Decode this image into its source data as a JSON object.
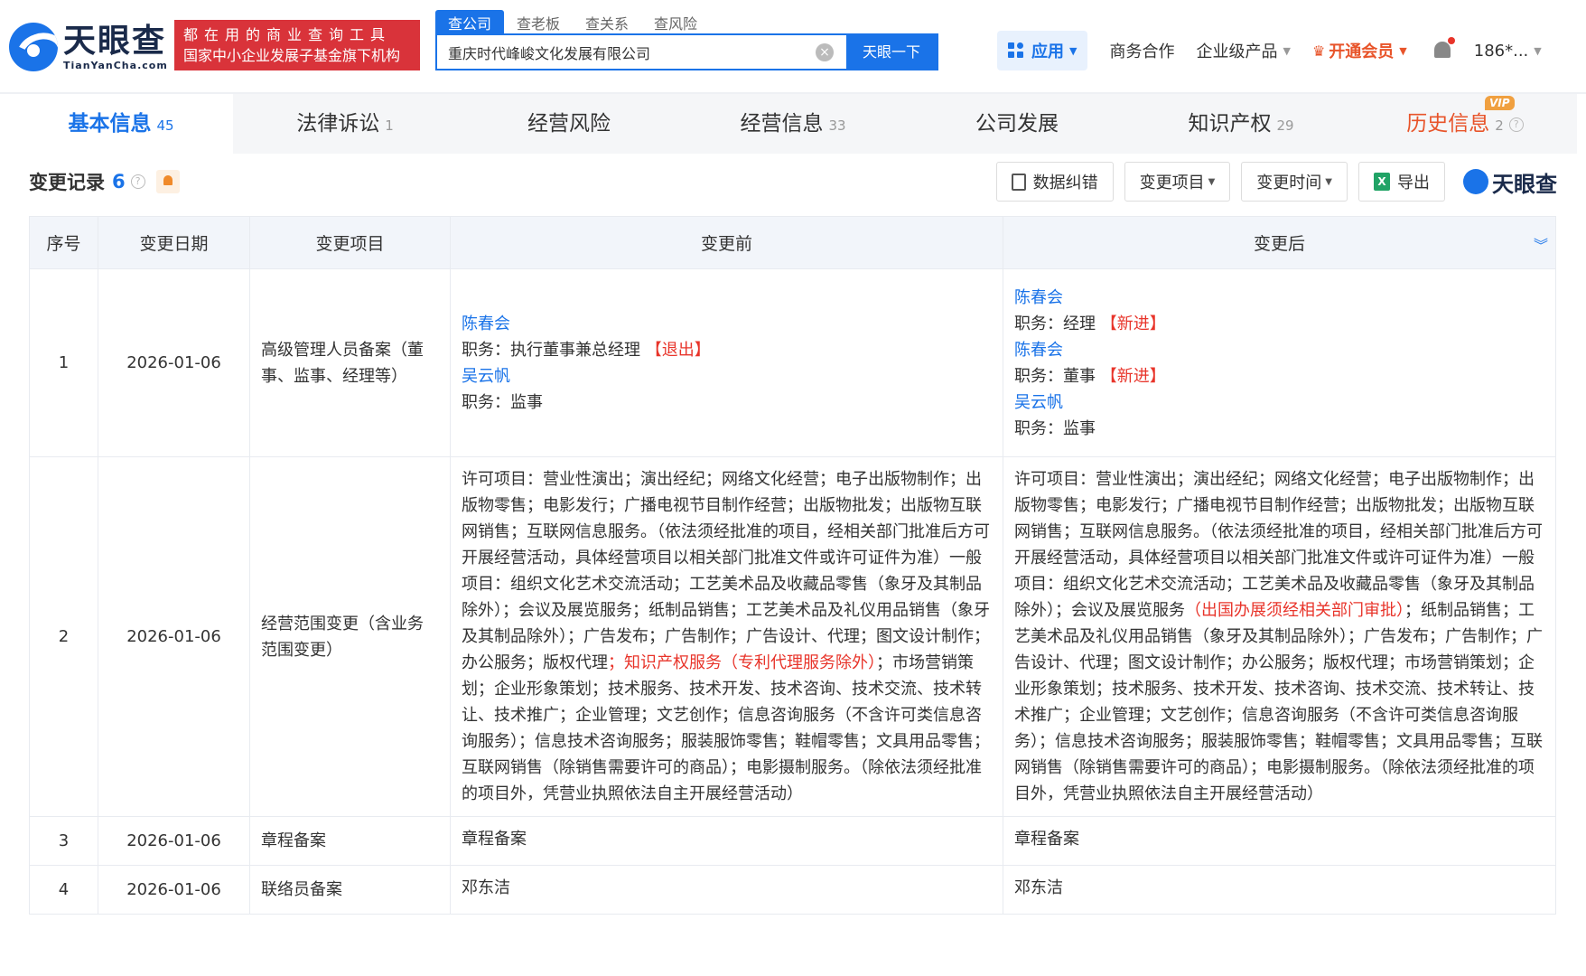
{
  "header": {
    "logo_cn": "天眼查",
    "logo_en": "TianYanCha.com",
    "slogan_line1": "都在用的商业查询工具",
    "slogan_line2": "国家中小企业发展子基金旗下机构",
    "search_tabs": [
      "查公司",
      "查老板",
      "查关系",
      "查风险"
    ],
    "search_value": "重庆时代峰峻文化发展有限公司",
    "search_button": "天眼一下",
    "apps_label": "应用",
    "nav_business": "商务合作",
    "nav_enterprise": "企业级产品",
    "nav_member": "开通会员",
    "user": "186*..."
  },
  "category_tabs": [
    {
      "label": "基本信息",
      "count": "45"
    },
    {
      "label": "法律诉讼",
      "count": "1"
    },
    {
      "label": "经营风险",
      "count": ""
    },
    {
      "label": "经营信息",
      "count": "33"
    },
    {
      "label": "公司发展",
      "count": ""
    },
    {
      "label": "知识产权",
      "count": "29"
    },
    {
      "label": "历史信息",
      "count": "2",
      "badge": "VIP"
    }
  ],
  "section": {
    "title": "变更记录",
    "count": "6",
    "tools": {
      "correction": "数据纠错",
      "change_item": "变更项目",
      "change_time": "变更时间",
      "export": "导出"
    },
    "brand": "天眼查"
  },
  "table": {
    "headers": [
      "序号",
      "变更日期",
      "变更项目",
      "变更前",
      "变更后"
    ],
    "rows": [
      {
        "no": "1",
        "date": "2026-01-06",
        "item": "高级管理人员备案（董事、监事、经理等）",
        "before": {
          "p1_name": "陈春会",
          "p1_role": "职务：执行董事兼总经理",
          "p1_tag": "【退出】",
          "p2_name": "吴云帆",
          "p2_role": "职务：监事"
        },
        "after": {
          "p1_name": "陈春会",
          "p1_role": "职务：经理",
          "p1_tag": "【新进】",
          "p2_name": "陈春会",
          "p2_role": "职务：董事",
          "p2_tag": "【新进】",
          "p3_name": "吴云帆",
          "p3_role": "职务：监事"
        }
      },
      {
        "no": "2",
        "date": "2026-01-06",
        "item": "经营范围变更（含业务范围变更）",
        "before": {
          "text1": "许可项目：营业性演出；演出经纪；网络文化经营；电子出版物制作；出版物零售；电影发行；广播电视节目制作经营；出版物批发；出版物互联网销售；互联网信息服务。（依法须经批准的项目，经相关部门批准后方可开展经营活动，具体经营项目以相关部门批准文件或许可证件为准）一般项目：组织文化艺术交流活动；工艺美术品及收藏品零售（象牙及其制品除外）；会议及展览服务；纸制品销售；工艺美术品及礼仪用品销售（象牙及其制品除外）；广告发布；广告制作；广告设计、代理；图文设计制作；办公服务；版权代理",
          "highlight": "；知识产权服务（专利代理服务除外）",
          "text2": "；市场营销策划；企业形象策划；技术服务、技术开发、技术咨询、技术交流、技术转让、技术推广；企业管理；文艺创作；信息咨询服务（不含许可类信息咨询服务）；信息技术咨询服务；服装服饰零售；鞋帽零售；文具用品零售；互联网销售（除销售需要许可的商品）；电影摄制服务。（除依法须经批准的项目外，凭营业执照依法自主开展经营活动）"
        },
        "after": {
          "text1": "许可项目：营业性演出；演出经纪；网络文化经营；电子出版物制作；出版物零售；电影发行；广播电视节目制作经营；出版物批发；出版物互联网销售；互联网信息服务。（依法须经批准的项目，经相关部门批准后方可开展经营活动，具体经营项目以相关部门批准文件或许可证件为准）一般项目：组织文化艺术交流活动；工艺美术品及收藏品零售（象牙及其制品除外）；会议及展览服务",
          "highlight": "（出国办展须经相关部门审批）",
          "text2": "；纸制品销售；工艺美术品及礼仪用品销售（象牙及其制品除外）；广告发布；广告制作；广告设计、代理；图文设计制作；办公服务；版权代理；市场营销策划；企业形象策划；技术服务、技术开发、技术咨询、技术交流、技术转让、技术推广；企业管理；文艺创作；信息咨询服务（不含许可类信息咨询服务）；信息技术咨询服务；服装服饰零售；鞋帽零售；文具用品零售；互联网销售（除销售需要许可的商品）；电影摄制服务。（除依法须经批准的项目外，凭营业执照依法自主开展经营活动）"
        }
      },
      {
        "no": "3",
        "date": "2026-01-06",
        "item": "章程备案",
        "before": "章程备案",
        "after": "章程备案"
      },
      {
        "no": "4",
        "date": "2026-01-06",
        "item": "联络员备案",
        "before": "邓东洁",
        "after": "邓东洁"
      }
    ]
  },
  "colors": {
    "primary": "#1a73e8",
    "red": "#e8342a",
    "slogan_bg": "#d9333a",
    "member": "#e8542a"
  }
}
